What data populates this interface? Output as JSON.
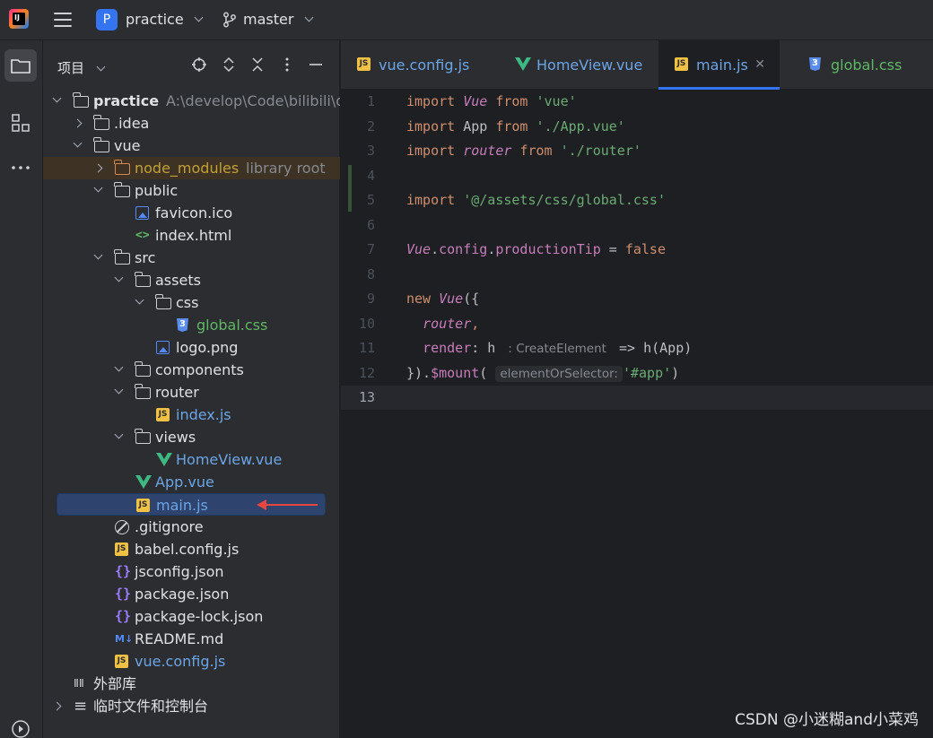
{
  "titlebar": {
    "app_logo": "jetbrains-ide-icon",
    "project_badge": "P",
    "project_name": "practice",
    "branch_name": "master"
  },
  "project_panel": {
    "title": "项目",
    "tools": [
      "locate-icon",
      "expand-all-icon",
      "collapse-all-icon",
      "more-options-icon",
      "hide-icon"
    ],
    "tree": [
      {
        "indent": 0,
        "arrow": "down",
        "icon": "folder",
        "label": "practice",
        "sub": "A:\\develop\\Code\\bilibili\\qi",
        "color": "default",
        "bold": true
      },
      {
        "indent": 1,
        "arrow": "right",
        "icon": "folder",
        "label": ".idea",
        "color": "default"
      },
      {
        "indent": 1,
        "arrow": "down",
        "icon": "folder",
        "label": "vue",
        "color": "default"
      },
      {
        "indent": 2,
        "arrow": "right",
        "icon": "folder-lib",
        "label": "node_modules",
        "sub": "library root",
        "color": "lib",
        "highlight": "lib"
      },
      {
        "indent": 2,
        "arrow": "down",
        "icon": "folder",
        "label": "public",
        "color": "default"
      },
      {
        "indent": 3,
        "arrow": "",
        "icon": "image",
        "label": "favicon.ico",
        "color": "default"
      },
      {
        "indent": 3,
        "arrow": "",
        "icon": "html",
        "label": "index.html",
        "color": "default"
      },
      {
        "indent": 2,
        "arrow": "down",
        "icon": "folder",
        "label": "src",
        "color": "default"
      },
      {
        "indent": 3,
        "arrow": "down",
        "icon": "folder",
        "label": "assets",
        "color": "default"
      },
      {
        "indent": 4,
        "arrow": "down",
        "icon": "folder",
        "label": "css",
        "color": "default"
      },
      {
        "indent": 5,
        "arrow": "",
        "icon": "css",
        "label": "global.css",
        "color": "green"
      },
      {
        "indent": 4,
        "arrow": "",
        "icon": "image",
        "label": "logo.png",
        "color": "default"
      },
      {
        "indent": 3,
        "arrow": "down",
        "icon": "folder",
        "label": "components",
        "color": "default"
      },
      {
        "indent": 3,
        "arrow": "down",
        "icon": "folder",
        "label": "router",
        "color": "default"
      },
      {
        "indent": 4,
        "arrow": "",
        "icon": "js",
        "label": "index.js",
        "color": "js"
      },
      {
        "indent": 3,
        "arrow": "down",
        "icon": "folder",
        "label": "views",
        "color": "default"
      },
      {
        "indent": 4,
        "arrow": "",
        "icon": "vue",
        "label": "HomeView.vue",
        "color": "js"
      },
      {
        "indent": 3,
        "arrow": "",
        "icon": "vue",
        "label": "App.vue",
        "color": "js"
      },
      {
        "indent": 3,
        "arrow": "",
        "icon": "js",
        "label": "main.js",
        "color": "js",
        "highlight": "sel"
      },
      {
        "indent": 2,
        "arrow": "",
        "icon": "ignore",
        "label": ".gitignore",
        "color": "default"
      },
      {
        "indent": 2,
        "arrow": "",
        "icon": "js",
        "label": "babel.config.js",
        "color": "default"
      },
      {
        "indent": 2,
        "arrow": "",
        "icon": "json",
        "label": "jsconfig.json",
        "color": "default"
      },
      {
        "indent": 2,
        "arrow": "",
        "icon": "json",
        "label": "package.json",
        "color": "default"
      },
      {
        "indent": 2,
        "arrow": "",
        "icon": "json",
        "label": "package-lock.json",
        "color": "default"
      },
      {
        "indent": 2,
        "arrow": "",
        "icon": "md",
        "label": "README.md",
        "color": "default"
      },
      {
        "indent": 2,
        "arrow": "",
        "icon": "js",
        "label": "vue.config.js",
        "color": "js"
      },
      {
        "indent": 0,
        "arrow": "",
        "icon": "library",
        "label": "外部库",
        "color": "default"
      },
      {
        "indent": 0,
        "arrow": "right",
        "icon": "scratch",
        "label": "临时文件和控制台",
        "color": "default"
      }
    ]
  },
  "tabs": [
    {
      "icon": "js",
      "label": "vue.config.js",
      "color": "js"
    },
    {
      "icon": "vue",
      "label": "HomeView.vue",
      "color": "js"
    },
    {
      "icon": "js",
      "label": "main.js",
      "color": "js",
      "active": true
    },
    {
      "icon": "css",
      "label": "global.css",
      "color": "green"
    }
  ],
  "editor": {
    "line_numbers": [
      "1",
      "2",
      "3",
      "4",
      "5",
      "6",
      "7",
      "8",
      "9",
      "10",
      "11",
      "12",
      "13"
    ],
    "current_line": "13",
    "hint_create_element": ": CreateElement",
    "hint_element_or_selector": "elementOrSelector:"
  },
  "watermark": "CSDN @小迷糊and小菜鸡"
}
